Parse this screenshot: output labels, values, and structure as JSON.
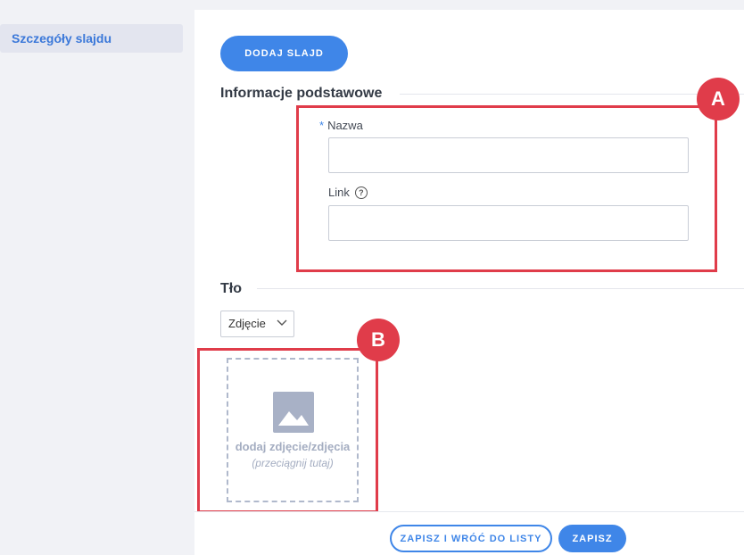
{
  "sidebar": {
    "items": [
      {
        "label": "Szczegóły slajdu"
      }
    ]
  },
  "toolbar": {
    "add_slide_label": "DODAJ SLAJD"
  },
  "basic_info": {
    "title": "Informacje podstawowe",
    "name_required_mark": "*",
    "name_label": "Nazwa",
    "name_value": "",
    "link_label": "Link",
    "link_help_glyph": "?",
    "link_value": ""
  },
  "background": {
    "title": "Tło",
    "type_select_value": "Zdjęcie",
    "dropzone_text": "dodaj zdjęcie/zdjęcia",
    "dropzone_hint": "(przeciągnij tutaj)"
  },
  "annotations": {
    "marker_a": "A",
    "marker_b": "B"
  },
  "footer": {
    "save_and_back_label": "ZAPISZ I WRÓĆ DO LISTY",
    "save_label": "ZAPISZ"
  },
  "colors": {
    "accent": "#3f86e8",
    "highlight": "#e03c4a",
    "sidebar_bg": "#f1f2f6"
  },
  "icons": {
    "image_placeholder": "image-icon",
    "help": "question-circle-icon",
    "select_chevron": "chevron-down-icon"
  }
}
